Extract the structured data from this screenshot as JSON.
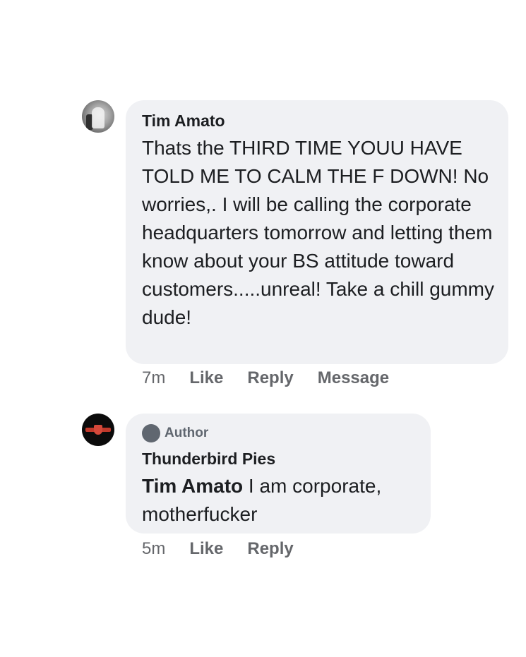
{
  "comments": [
    {
      "author": "Tim Amato",
      "text": "Thats the THIRD TIME YOUU HAVE TOLD ME TO CALM THE F DOWN! No worries,. I will be calling the corporate headquarters tomorrow and letting them know about your BS attitude toward customers.....unreal! Take a chill gummy dude!",
      "time": "7m",
      "actions": {
        "like": "Like",
        "reply": "Reply",
        "message": "Message"
      }
    },
    {
      "badge": "Author",
      "author": "Thunderbird Pies",
      "mention": "Tim Amato",
      "text": " I am corporate, motherfucker",
      "time": "5m",
      "actions": {
        "like": "Like",
        "reply": "Reply"
      }
    }
  ]
}
